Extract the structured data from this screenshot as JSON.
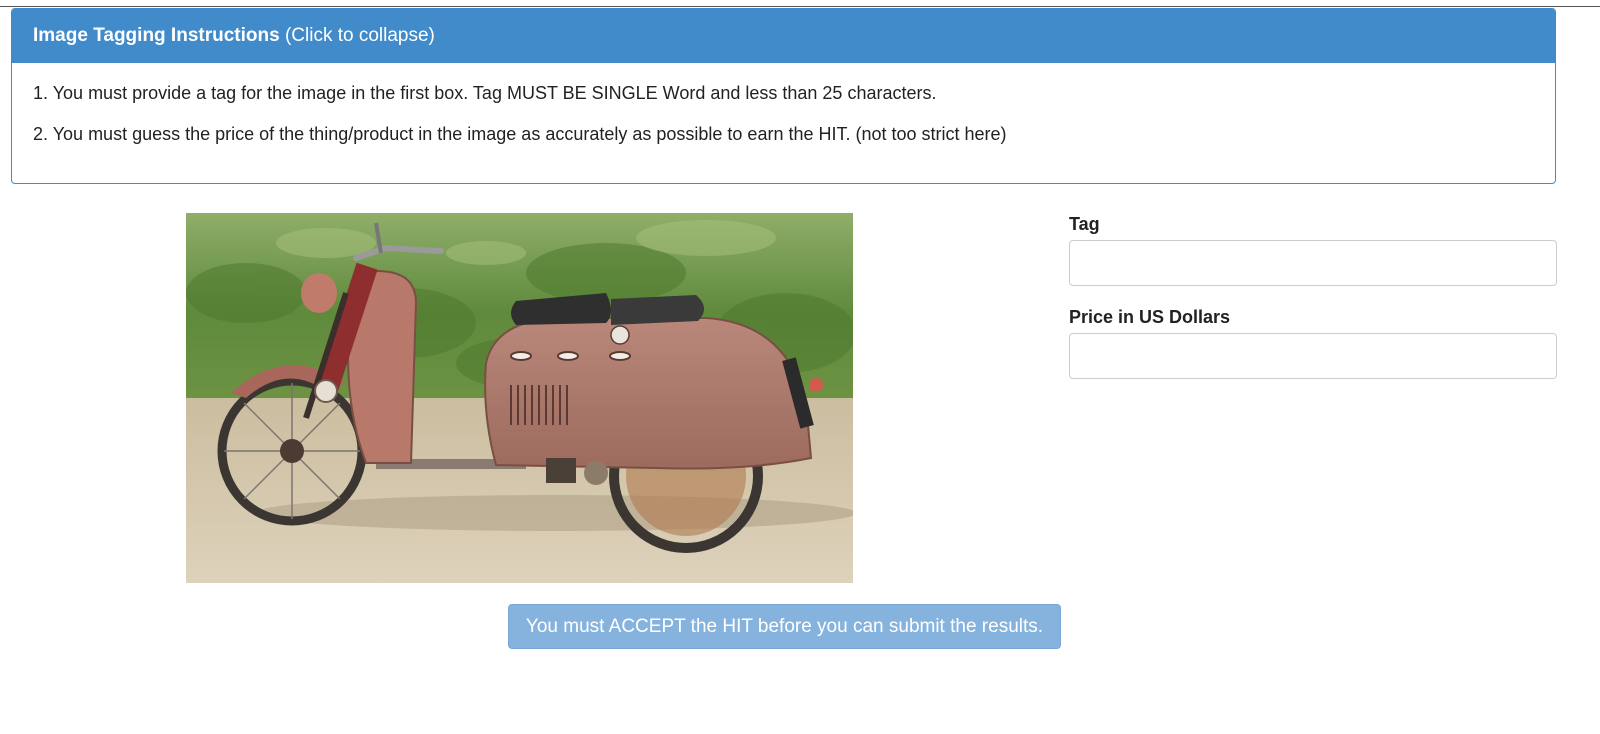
{
  "instructions_panel": {
    "title": "Image Tagging Instructions",
    "collapse_hint": "(Click to collapse)",
    "items": [
      "1. You must provide a tag for the image in the first box. Tag MUST BE SINGLE Word and less than 25 characters.",
      "2. You must guess the price of the thing/product in the image as accurately as possible to earn the HIT. (not too strict here)"
    ]
  },
  "form": {
    "tag": {
      "label": "Tag",
      "value": "",
      "placeholder": ""
    },
    "price": {
      "label": "Price in US Dollars",
      "value": "",
      "placeholder": ""
    },
    "submit_label": "You must ACCEPT the HIT before you can submit the results."
  },
  "colors": {
    "panel_primary": "#428bca",
    "button_disabled": "#86b3de"
  }
}
